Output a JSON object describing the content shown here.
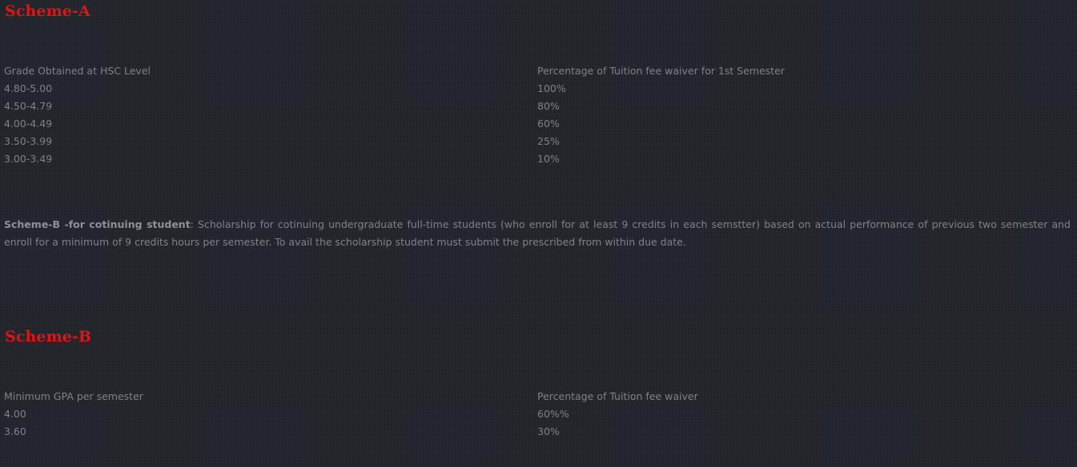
{
  "scheme_a": {
    "title": "Scheme-A",
    "header": {
      "col1": "Grade Obtained at HSC Level",
      "col2": "Percentage of Tuition fee waiver for 1st Semester"
    },
    "rows": [
      {
        "grade": "4.80-5.00",
        "waiver": "100%"
      },
      {
        "grade": "4.50-4.79",
        "waiver": "80%"
      },
      {
        "grade": "4.00-4.49",
        "waiver": "60%"
      },
      {
        "grade": "3.50-3.99",
        "waiver": "25%"
      },
      {
        "grade": "3.00-3.49",
        "waiver": "10%"
      }
    ]
  },
  "scheme_b_description": {
    "lead": "Scheme-B -for cotinuing student",
    "text": ": Scholarship for cotinuing undergraduate full-time students (who enroll for at least 9 credits in each semstter) based on actual performance of previous two semester and enroll for a minimum of 9 credits hours per semester. To avail the scholarship student must submit the prescribed from within due date."
  },
  "scheme_b": {
    "title": "Scheme-B",
    "header": {
      "col1": "Minimum GPA per semester",
      "col2": "Percentage of Tuition fee waiver"
    },
    "rows": [
      {
        "gpa": "4.00",
        "waiver": "60%%"
      },
      {
        "gpa": "3.60",
        "waiver": "30%"
      }
    ]
  },
  "colors": {
    "heading": "#e01414",
    "text": "#7e8187",
    "background": "#23262d"
  }
}
